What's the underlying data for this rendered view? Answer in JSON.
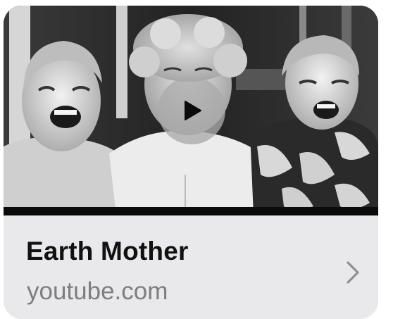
{
  "link_preview": {
    "title": "Earth Mother",
    "domain": "youtube.com",
    "media_type": "video",
    "play_icon": "play-icon",
    "chevron_icon": "chevron-right-icon"
  },
  "colors": {
    "card_background": "#e9e9eb",
    "title": "#111111",
    "domain": "#7d7d82",
    "play_button": "#aaaaaa",
    "chevron": "#8e8e93"
  }
}
